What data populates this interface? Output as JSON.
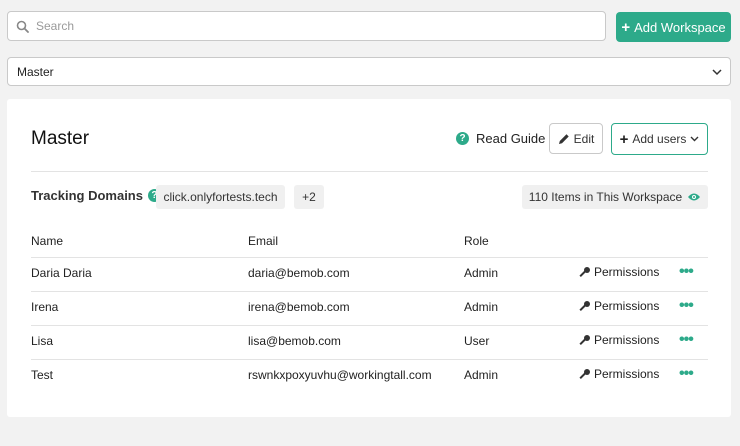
{
  "search": {
    "placeholder": "Search",
    "value": ""
  },
  "toolbar": {
    "add_workspace_label": "Add Workspace"
  },
  "workspace_select": {
    "selected": "Master"
  },
  "workspace": {
    "title": "Master",
    "read_guide_label": "Read Guide",
    "edit_label": "Edit",
    "add_users_label": "Add users",
    "tracking_domains_label": "Tracking Domains",
    "domain_chip": "click.onlyfortests.tech",
    "more_domains": "+2",
    "items_count": "110 Items in This Workspace"
  },
  "table": {
    "headers": {
      "name": "Name",
      "email": "Email",
      "role": "Role"
    },
    "permissions_label": "Permissions",
    "rows": [
      {
        "name": "Daria Daria",
        "email": "daria@bemob.com",
        "role": "Admin"
      },
      {
        "name": "Irena",
        "email": "irena@bemob.com",
        "role": "Admin"
      },
      {
        "name": "Lisa",
        "email": "lisa@bemob.com",
        "role": "User"
      },
      {
        "name": "Test",
        "email": "rswnkxpoxyuvhu@workingtall.com",
        "role": "Admin"
      }
    ]
  },
  "colors": {
    "accent": "#2daa8a",
    "background": "#f2f2f2",
    "card": "#ffffff"
  }
}
